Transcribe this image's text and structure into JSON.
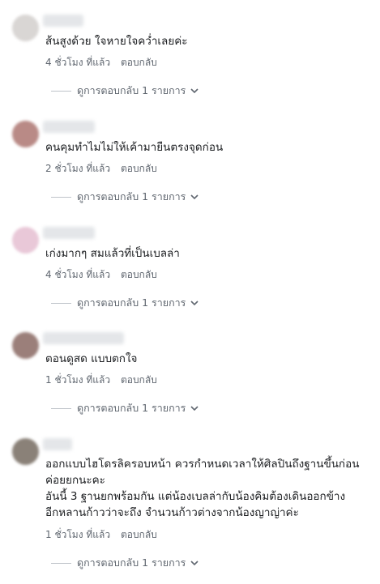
{
  "comments": [
    {
      "text_lines": [
        "ส้นสูงด้วย ใจหายใจคว่ำเลยค่ะ"
      ],
      "time": "4 ชั่วโมง ที่แล้ว",
      "reply": "ตอบกลับ",
      "view_replies": "ดูการตอบกลับ 1 รายการ",
      "avatar_color": "#d9d6d4"
    },
    {
      "text_lines": [
        "คนคุมทำไมไม่ให้เค้ามายืนตรงจุดก่อน"
      ],
      "time": "2 ชั่วโมง ที่แล้ว",
      "reply": "ตอบกลับ",
      "view_replies": "ดูการตอบกลับ 1 รายการ",
      "avatar_color": "#b98a86"
    },
    {
      "text_lines": [
        "เก่งมากๆ สมแล้วที่เป็นเบลล่า"
      ],
      "time": "4 ชั่วโมง ที่แล้ว",
      "reply": "ตอบกลับ",
      "view_replies": "ดูการตอบกลับ 1 รายการ",
      "avatar_color": "#e9c8d8"
    },
    {
      "text_lines": [
        "ตอนดูสด แบบตกใจ"
      ],
      "time": "1 ชั่วโมง ที่แล้ว",
      "reply": "ตอบกลับ",
      "view_replies": "ดูการตอบกลับ 1 รายการ",
      "avatar_color": "#9b7f7a"
    },
    {
      "text_lines": [
        "ออกแบบไฮโดรลิครอบหน้า ควรกำหนดเวลาให้ศิลปินถึงฐานขึ้นก่อน",
        "ค่อยยกนะคะ",
        "อันนี้ 3 ฐานยกพร้อมกัน แต่น้องเบลล่ากับน้องคิมต้องเดินออกข้าง",
        "อีกหลานก้าวว่าจะถึง จำนวนก้าวต่างจากน้องญาญ่าค่ะ"
      ],
      "time": "1 ชั่วโมง ที่แล้ว",
      "reply": "ตอบกลับ",
      "view_replies": "ดูการตอบกลับ 1 รายการ",
      "avatar_color": "#8a8178"
    }
  ]
}
